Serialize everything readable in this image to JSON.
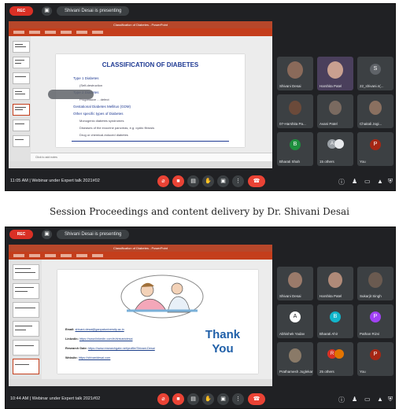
{
  "caption": "Session Proceedings and content delivery by Dr. Shivani Desai",
  "shot1": {
    "rec_label": "REC",
    "presenting_text": "Shivani Desai is presenting",
    "ppt_title": "Classification of Diabetes - PowerPoint",
    "slide_title": "CLASSIFICATION OF DIABETES",
    "bullets": [
      "Type 1 Diabetes",
      "(Self-destruction",
      "Type 2 Diabetes",
      "Progressive ... defect",
      "Gestational Diabetes Mellitus (GDM)",
      "Other specific types of Diabetes",
      "Monogenic diabetes syndromes",
      "Diseases of the exocrine pancreas, e.g. cystic fibrosis",
      "Drug or chemical-induced diabetes"
    ],
    "notes_text": "Click to add notes",
    "meeting_time": "11:05 AM",
    "meeting_name": "Webinar under Expert talk 2021#02",
    "participants": [
      {
        "name": "Shivani Desai",
        "kind": "photo"
      },
      {
        "name": "Harshita Patel",
        "kind": "photo"
      },
      {
        "name": "22_shivani.n(...",
        "kind": "letter",
        "letter": "S"
      },
      {
        "name": "07-Harshita Pa...",
        "kind": "photo"
      },
      {
        "name": "Avani Patel",
        "kind": "photo"
      },
      {
        "name": "Chaitali Jogi...",
        "kind": "photo"
      },
      {
        "name": "Bharati Shah",
        "kind": "letter",
        "letter": "B"
      },
      {
        "name": "15 others",
        "kind": "group",
        "letter": "A"
      },
      {
        "name": "You",
        "kind": "letter",
        "letter": "P"
      }
    ]
  },
  "shot2": {
    "rec_label": "REC",
    "presenting_text": "Shivani Desai is presenting",
    "ppt_title": "Classification of Diabetes - PowerPoint",
    "thankyou_line1": "Thank",
    "thankyou_line2": "You",
    "contacts": [
      {
        "label": "Email:",
        "value": "shivani.desai@ganpatuniversity.ac.in"
      },
      {
        "label": "LinkedIn:",
        "value": "https://www.linkedin.com/in/shivanidesai"
      },
      {
        "label": "Research Gate:",
        "value": "https://www.researchgate.net/profile/Shivani-Desai"
      },
      {
        "label": "Website:",
        "value": "https://shivanidesai.com"
      }
    ],
    "meeting_time": "10:44 AM",
    "meeting_name": "Webinar under Expert talk 2021#02",
    "participants": [
      {
        "name": "Shivani Desai",
        "kind": "photo"
      },
      {
        "name": "Harshita Patel",
        "kind": "photo"
      },
      {
        "name": "Sukarjit Singh",
        "kind": "photo"
      },
      {
        "name": "Abhishek Yadav",
        "kind": "letter",
        "letter": "A"
      },
      {
        "name": "Bharati Ahir",
        "kind": "letter",
        "letter": "B"
      },
      {
        "name": "Pathan Rizvi",
        "kind": "letter",
        "letter": "P"
      },
      {
        "name": "Prathamesh Joglekar",
        "kind": "photo"
      },
      {
        "name": "25 others",
        "kind": "group",
        "letter": "R"
      },
      {
        "name": "You",
        "kind": "letter",
        "letter": "P"
      }
    ]
  },
  "colors": {
    "meet_bg": "#202124",
    "tile_bg": "#3c4043",
    "rec_red": "#d93025",
    "ppt_orange": "#c43e1c",
    "slide_blue": "#1f3a93"
  },
  "icons": {
    "controls": [
      "mic-off-icon",
      "camera-off-icon",
      "captions-icon",
      "raise-hand-icon",
      "present-icon",
      "more-icon",
      "end-call-icon"
    ],
    "right": [
      "info-icon",
      "people-icon",
      "chat-icon",
      "activities-icon",
      "lock-icon"
    ]
  }
}
